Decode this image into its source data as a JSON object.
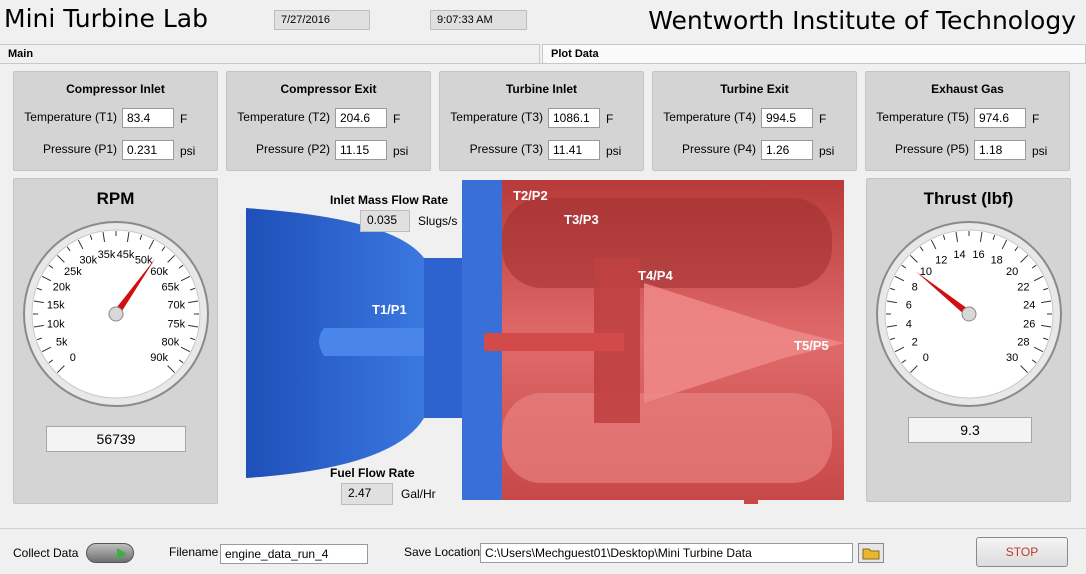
{
  "header": {
    "app_title": "Mini Turbine Lab",
    "date": "7/27/2016",
    "time": "9:07:33 AM",
    "org_title": "Wentworth Institute of Technology"
  },
  "tabs": [
    {
      "label": "Main"
    },
    {
      "label": "Plot Data"
    }
  ],
  "sensors": [
    {
      "title": "Compressor Inlet",
      "temp_label": "Temperature (T1)",
      "temp_value": "83.4",
      "temp_unit": "F",
      "pres_label": "Pressure (P1)",
      "pres_value": "0.231",
      "pres_unit": "psi"
    },
    {
      "title": "Compressor Exit",
      "temp_label": "Temperature (T2)",
      "temp_value": "204.6",
      "temp_unit": "F",
      "pres_label": "Pressure (P2)",
      "pres_value": "11.15",
      "pres_unit": "psi"
    },
    {
      "title": "Turbine Inlet",
      "temp_label": "Temperature (T3)",
      "temp_value": "1086.1",
      "temp_unit": "F",
      "pres_label": "Pressure (T3)",
      "pres_value": "11.41",
      "pres_unit": "psi"
    },
    {
      "title": "Turbine Exit",
      "temp_label": "Temperature (T4)",
      "temp_value": "994.5",
      "temp_unit": "F",
      "pres_label": "Pressure (P4)",
      "pres_value": "1.26",
      "pres_unit": "psi"
    },
    {
      "title": "Exhaust Gas",
      "temp_label": "Temperature (T5)",
      "temp_value": "974.6",
      "temp_unit": "F",
      "pres_label": "Pressure (P5)",
      "pres_value": "1.18",
      "pres_unit": "psi"
    }
  ],
  "rpm_gauge": {
    "title": "RPM",
    "value": 56739,
    "readout": "56739",
    "min": 0,
    "max": 90000,
    "tick_labels": [
      "0",
      "5k",
      "10k",
      "15k",
      "20k",
      "25k",
      "30k",
      "35k",
      "45k",
      "50k",
      "60k",
      "65k",
      "70k",
      "75k",
      "80k",
      "90k"
    ],
    "needle_color": "#d01010"
  },
  "thrust_gauge": {
    "title": "Thrust (lbf)",
    "value": 9.3,
    "readout": "9.3",
    "min": 0,
    "max": 30,
    "tick_labels": [
      "0",
      "2",
      "4",
      "6",
      "8",
      "10",
      "12",
      "14",
      "16",
      "18",
      "20",
      "22",
      "24",
      "26",
      "28",
      "30"
    ],
    "needle_color": "#d01010"
  },
  "diagram": {
    "station_labels": [
      "T1/P1",
      "T2/P2",
      "T3/P3",
      "T4/P4",
      "T5/P5"
    ],
    "compressor_color": "#2a5fc9",
    "turbine_color": "#d94a4a"
  },
  "flow": {
    "inlet_label": "Inlet Mass Flow Rate",
    "inlet_value": "0.035",
    "inlet_unit": "Slugs/s",
    "fuel_label": "Fuel Flow Rate",
    "fuel_value": "2.47",
    "fuel_unit": "Gal/Hr"
  },
  "bottom": {
    "collect_label": "Collect Data",
    "filename_label": "Filename",
    "filename_value": "engine_data_run_4",
    "save_label": "Save Location",
    "save_value": "C:\\Users\\Mechguest01\\Desktop\\Mini Turbine Data",
    "stop_label": "STOP",
    "folder_icon": "folder-icon"
  }
}
